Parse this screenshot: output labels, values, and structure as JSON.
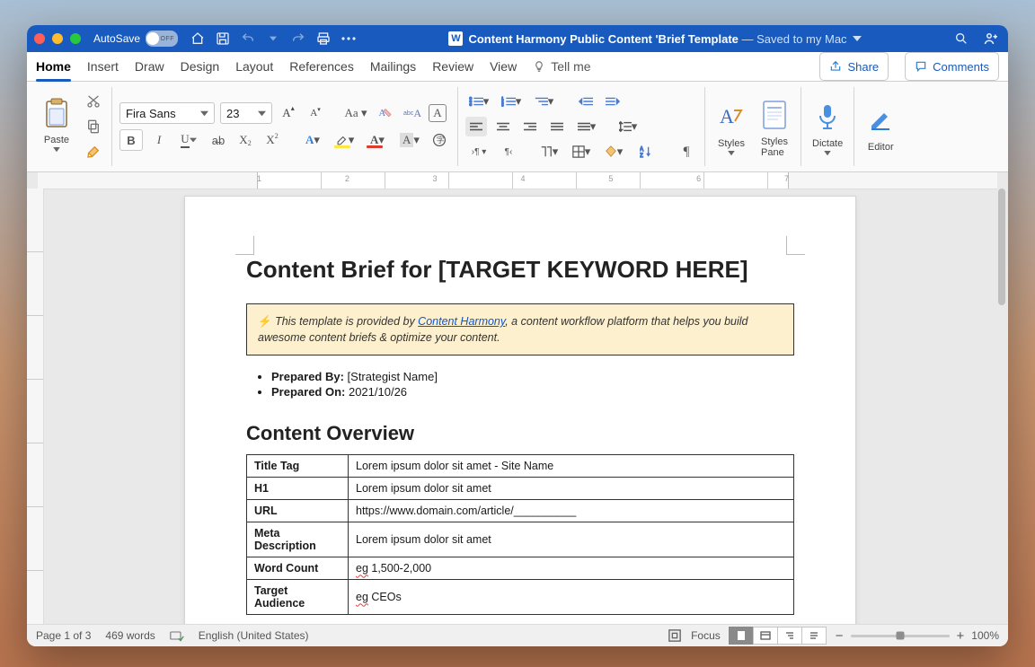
{
  "titlebar": {
    "autosave_label": "AutoSave",
    "autosave_state": "OFF",
    "doc_icon": "W",
    "doc_title": "Content Harmony Public Content 'Brief Template",
    "saved_suffix": " — Saved to my Mac"
  },
  "tabs": {
    "items": [
      "Home",
      "Insert",
      "Draw",
      "Design",
      "Layout",
      "References",
      "Mailings",
      "Review",
      "View"
    ],
    "active": "Home",
    "tell_me": "Tell me",
    "share": "Share",
    "comments": "Comments"
  },
  "ribbon": {
    "paste": "Paste",
    "font_name": "Fira Sans",
    "font_size": "23",
    "styles": "Styles",
    "styles_pane": "Styles\nPane",
    "dictate": "Dictate",
    "editor": "Editor"
  },
  "ruler": {
    "marks": [
      "1",
      "2",
      "3",
      "4",
      "5",
      "6",
      "7"
    ]
  },
  "document": {
    "h1": "Content Brief for [TARGET KEYWORD HERE]",
    "notice_pre": "This template is provided by ",
    "notice_link": "Content Harmony",
    "notice_post": ", a content workflow platform that helps you build awesome content briefs & optimize your content.",
    "meta": [
      {
        "label": "Prepared By:",
        "value": " [Strategist Name]"
      },
      {
        "label": "Prepared On:",
        "value": " 2021/10/26"
      }
    ],
    "h2": "Content Overview",
    "table": [
      {
        "k": "Title Tag",
        "v": "Lorem ipsum dolor sit amet - Site Name"
      },
      {
        "k": "H1",
        "v": "Lorem ipsum dolor sit amet"
      },
      {
        "k": "URL",
        "v": "https://www.domain.com/article/__________"
      },
      {
        "k": "Meta Description",
        "v": "Lorem ipsum dolor sit amet"
      },
      {
        "k": "Word Count",
        "v_pre": "eg",
        "v": " 1,500-2,000"
      },
      {
        "k": "Target Audience",
        "v_pre": "eg",
        "v": " CEOs"
      }
    ]
  },
  "statusbar": {
    "page": "Page 1 of 3",
    "words": "469 words",
    "language": "English (United States)",
    "focus": "Focus",
    "zoom": "100%"
  }
}
